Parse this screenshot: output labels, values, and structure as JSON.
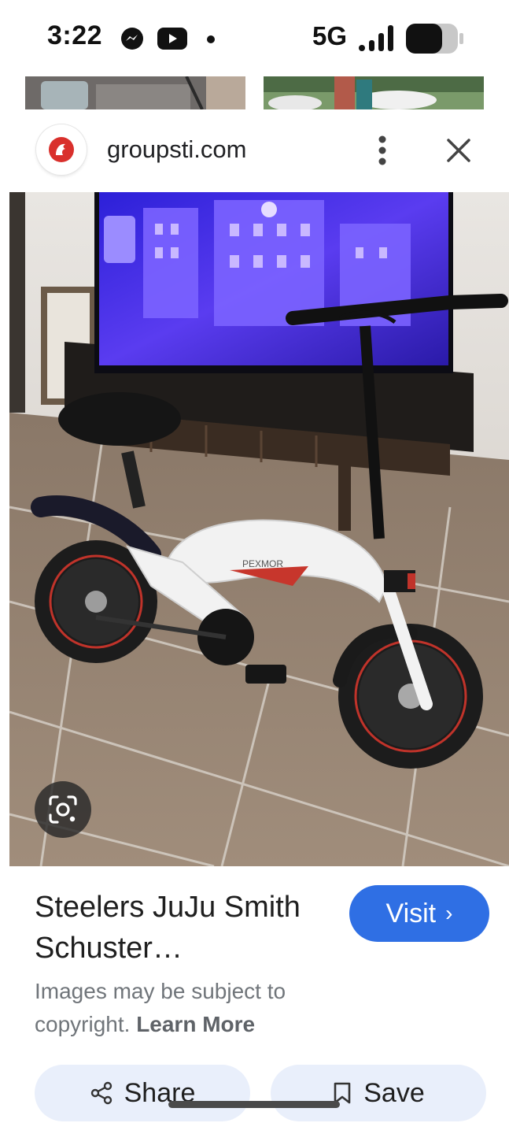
{
  "status_bar": {
    "time": "3:22",
    "network": "5G",
    "notification_icons": [
      "messenger-icon",
      "youtube-icon",
      "dot-icon"
    ],
    "system_icons": [
      "signal-icon",
      "battery-icon"
    ]
  },
  "viewer": {
    "site": "groupsti.com",
    "title": "Steelers JuJu Smith Schuster…",
    "visit_label": "Visit",
    "copyright_text": "Images may be subject to copyright.",
    "learn_more_label": "Learn More",
    "share_label": "Share",
    "save_label": "Save",
    "image_brand_text": "PEXMOR"
  },
  "colors": {
    "accent": "#2f6fe4",
    "pill_bg": "#e9effb",
    "secondary_text": "#70757a"
  }
}
